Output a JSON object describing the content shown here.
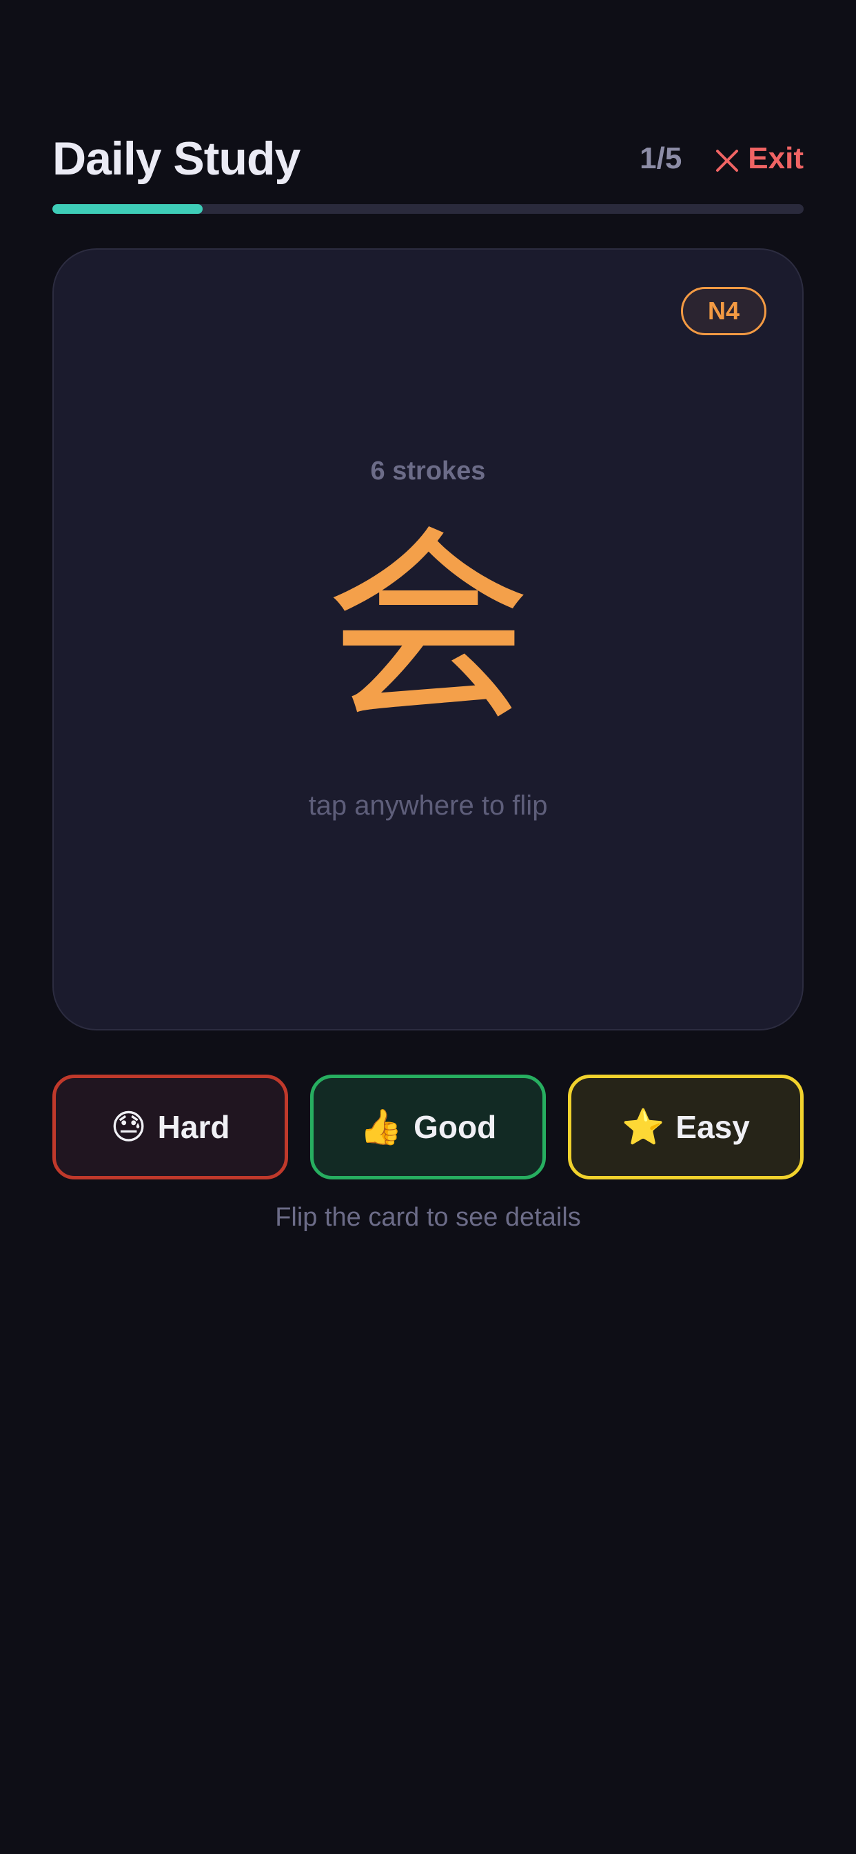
{
  "header": {
    "title": "Daily Study",
    "counter": "1/5",
    "exit_label": "Exit"
  },
  "progress": {
    "value_percent": 20,
    "fill_color": "#3ecdb8"
  },
  "card": {
    "level": "N4",
    "strokes": "6 strokes",
    "kanji": "会",
    "hint": "tap anywhere to flip"
  },
  "ratings": {
    "hard": {
      "emoji": "😓",
      "label": "Hard",
      "color": "#c0392b"
    },
    "good": {
      "emoji": "👍",
      "label": "Good",
      "color": "#27ae60"
    },
    "easy": {
      "emoji": "⭐",
      "label": "Easy",
      "color": "#f1d22d"
    }
  },
  "footer_hint": "Flip the card to see details",
  "colors": {
    "background": "#0e0e16",
    "card": "#1b1b2d",
    "accent_orange": "#f39a43",
    "exit_red": "#f06464"
  }
}
